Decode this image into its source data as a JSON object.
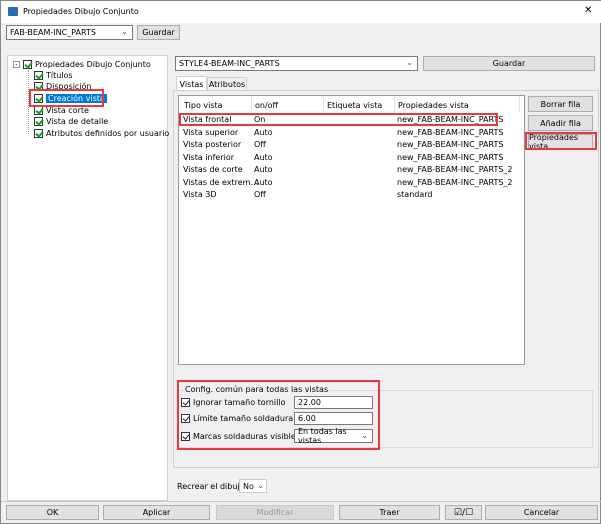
{
  "window": {
    "title": "Propiedades Dibujo Conjunto",
    "close": "✕"
  },
  "top": {
    "preset": "FAB-BEAM-INC_PARTS",
    "save": "Guardar"
  },
  "tree": {
    "root": "Propiedades Dibujo Conjunto",
    "items": [
      "Títulos",
      "Disposición",
      "Creación vista",
      "Vista corte",
      "Vista de detalle",
      "Atributos definidos por usuario"
    ],
    "selected": "Creación vista"
  },
  "right": {
    "preset": "STYLE4-BEAM-INC_PARTS",
    "save": "Guardar"
  },
  "tabs": [
    "Vistas",
    "Atributos"
  ],
  "table": {
    "headers": [
      "Tipo vista",
      "on/off",
      "Etiqueta vista",
      "Propiedades vista"
    ],
    "rows": [
      [
        "Vista frontal",
        "On",
        "",
        "new_FAB-BEAM-INC_PARTS"
      ],
      [
        "Vista superior",
        "Auto",
        "",
        "new_FAB-BEAM-INC_PARTS"
      ],
      [
        "Vista posterior",
        "Off",
        "",
        "new_FAB-BEAM-INC_PARTS"
      ],
      [
        "Vista inferior",
        "Auto",
        "",
        "new_FAB-BEAM-INC_PARTS"
      ],
      [
        "Vistas de corte",
        "Auto",
        "",
        "new_FAB-BEAM-INC_PARTS_2"
      ],
      [
        "Vistas de extrem…",
        "Auto",
        "",
        "new_FAB-BEAM-INC_PARTS_2"
      ],
      [
        "Vista 3D",
        "Off",
        "",
        "standard"
      ]
    ]
  },
  "side_buttons": {
    "delete": "Borrar fila",
    "add": "Añadir fila",
    "props": "Propiedades vista"
  },
  "common": {
    "title": "Config. común para todas las vistas",
    "bolt_label": "Ignorar tamaño tornillo",
    "bolt_value": "22.00",
    "weld_label": "Límite tamaño soldadura",
    "weld_value": "6.00",
    "marks_label": "Marcas soldaduras visibles:",
    "marks_value": "En todas las vistas"
  },
  "recreate": {
    "label": "Recrear el dibujo",
    "value": "No"
  },
  "bottom": {
    "ok": "OK",
    "apply": "Aplicar",
    "modify": "Modificar",
    "get": "Traer",
    "toggle": "☑/☐",
    "cancel": "Cancelar"
  },
  "colors": {
    "highlight": "#e8393f",
    "selection": "#0078d7",
    "check": "#1aa01a"
  }
}
